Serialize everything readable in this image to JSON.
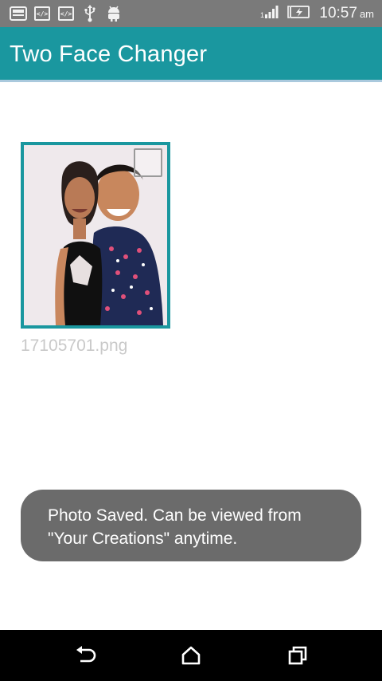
{
  "status_bar": {
    "time": "10:57",
    "ampm": "am",
    "icons": [
      "notification-icon",
      "code-icon",
      "code-icon",
      "usb-icon",
      "android-icon",
      "signal-icon",
      "battery-charging-icon"
    ]
  },
  "app_bar": {
    "title": "Two Face Changer",
    "color": "#1a979f"
  },
  "gallery": {
    "items": [
      {
        "file_name": "17105701.png",
        "checked": false
      }
    ]
  },
  "toast": {
    "line1": "Photo Saved. Can be viewed from",
    "line2": "\"Your Creations\" anytime."
  },
  "nav_bar": {
    "buttons": [
      "back-icon",
      "home-icon",
      "recents-icon"
    ]
  }
}
